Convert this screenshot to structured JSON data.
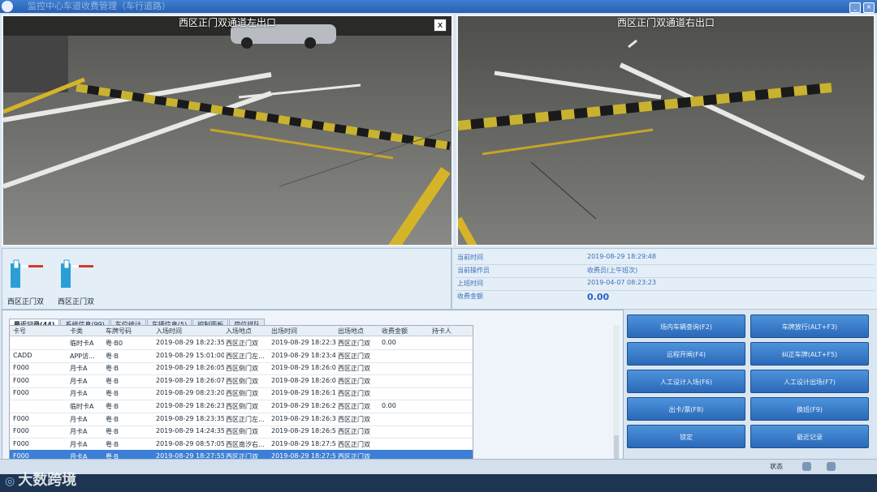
{
  "window": {
    "title": "监控中心车道收费管理（车行道路）"
  },
  "cameras": [
    {
      "title": "西区正门双通道左出口",
      "close_label": "x"
    },
    {
      "title": "西区正门双通道右出口"
    }
  ],
  "gates": [
    {
      "label": "西区正门双"
    },
    {
      "label": "西区正门双"
    }
  ],
  "info": {
    "rows": [
      {
        "key": "当前时间",
        "value": "2019-08-29 18:29:48"
      },
      {
        "key": "当前操作员",
        "value": "收费员(上午班次)"
      },
      {
        "key": "上班时间",
        "value": "2019-04-07 08:23:23"
      },
      {
        "key": "收费金额",
        "value": "0.00"
      }
    ]
  },
  "records": {
    "tabs": [
      "最近记录(44)",
      "系统信息(99)",
      "车位统计",
      "车辆信息(5)",
      "控制面板",
      "岗位排队"
    ],
    "columns": [
      "卡号",
      "卡类",
      "车牌号码",
      "入场时间",
      "入场地点",
      "出场时间",
      "出场地点",
      "收费金额",
      "持卡人"
    ],
    "rows": [
      {
        "card": "",
        "type": "临时卡A",
        "plate": "粤·B0",
        "in_time": "2019-08-29 18:22:35",
        "in_place": "西区正门双",
        "out_time": "2019-08-29 18:22:35",
        "out_place": "西区正门双",
        "fee": "0.00",
        "holder": ""
      },
      {
        "card": "CADD",
        "type": "APP访...",
        "plate": "粤·B",
        "in_time": "2019-08-29 15:01:00",
        "in_place": "西区正门左...",
        "out_time": "2019-08-29 18:23:40",
        "out_place": "西区正门双",
        "fee": "",
        "holder": ""
      },
      {
        "card": "F000",
        "type": "月卡A",
        "plate": "粤·B",
        "in_time": "2019-08-29 18:26:05",
        "in_place": "西区倒门双",
        "out_time": "2019-08-29 18:26:05",
        "out_place": "西区正门双",
        "fee": "",
        "holder": ""
      },
      {
        "card": "F000",
        "type": "月卡A",
        "plate": "粤·B",
        "in_time": "2019-08-29 18:26:07",
        "in_place": "西区倒门双",
        "out_time": "2019-08-29 18:26:07",
        "out_place": "西区正门双",
        "fee": "",
        "holder": ""
      },
      {
        "card": "F000",
        "type": "月卡A",
        "plate": "粤·B",
        "in_time": "2019-08-29 08:23:20",
        "in_place": "西区倒门双",
        "out_time": "2019-08-29 18:26:10",
        "out_place": "西区正门双",
        "fee": "",
        "holder": ""
      },
      {
        "card": "",
        "type": "临时卡A",
        "plate": "粤·B",
        "in_time": "2019-08-29 18:26:23",
        "in_place": "西区倒门双",
        "out_time": "2019-08-29 18:26:23",
        "out_place": "西区正门双",
        "fee": "0.00",
        "holder": ""
      },
      {
        "card": "F000",
        "type": "月卡A",
        "plate": "粤·B",
        "in_time": "2019-08-29 18:23:35",
        "in_place": "西区正门左...",
        "out_time": "2019-08-29 18:26:31",
        "out_place": "西区正门双",
        "fee": "",
        "holder": ""
      },
      {
        "card": "F000",
        "type": "月卡A",
        "plate": "粤·B",
        "in_time": "2019-08-29 14:24:35",
        "in_place": "西区倒门双",
        "out_time": "2019-08-29 18:26:55",
        "out_place": "西区正门双",
        "fee": "",
        "holder": ""
      },
      {
        "card": "F000",
        "type": "月卡A",
        "plate": "粤·B",
        "in_time": "2019-08-29 08:57:05",
        "in_place": "西区南汐右...",
        "out_time": "2019-08-29 18:27:55",
        "out_place": "西区正门双",
        "fee": "",
        "holder": ""
      },
      {
        "card": "F000",
        "type": "月卡A",
        "plate": "粤·B",
        "in_time": "2019-08-29 18:27:55",
        "in_place": "西区正门双",
        "out_time": "2019-08-29 18:27:55",
        "out_place": "西区正门双",
        "fee": "",
        "holder": "",
        "selected": true
      }
    ]
  },
  "buttons": [
    {
      "label": "场内车辆查询(F2)"
    },
    {
      "label": "车牌放行(ALT+F3)"
    },
    {
      "label": "远程开闸(F4)"
    },
    {
      "label": "纠正车牌(ALT+F5)"
    },
    {
      "label": "人工设计入场(F6)"
    },
    {
      "label": "人工设计出场(F7)"
    },
    {
      "label": "出卡/票(F8)"
    },
    {
      "label": "换班(F9)"
    },
    {
      "label": "锁定"
    },
    {
      "label": "最近记录"
    }
  ],
  "status": {
    "text": "状态"
  },
  "watermark": {
    "text": "大数跨境"
  },
  "colors": {
    "accent": "#2a69b8",
    "selected_row": "#3b7fd6",
    "fee_value": "#2a60c8"
  }
}
